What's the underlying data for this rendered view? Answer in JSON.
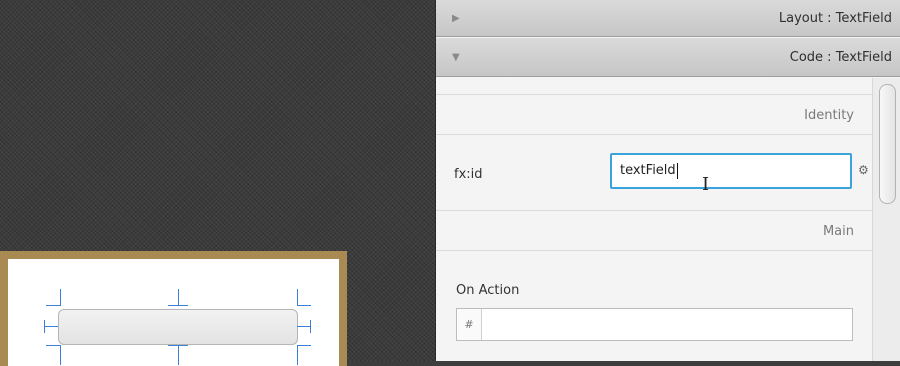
{
  "inspector": {
    "layout_header": "Layout : TextField",
    "code_header": "Code : TextField",
    "layout_arrow": "▶",
    "code_arrow": "▼",
    "sections": {
      "identity": "Identity",
      "main": "Main"
    },
    "fx_id": {
      "label": "fx:id",
      "value": "textField"
    },
    "on_action": {
      "label": "On Action",
      "prefix": "#",
      "value": ""
    },
    "gear_glyph": "⚙"
  },
  "icons": {
    "layout_collapse": "triangle-right-icon",
    "code_expand": "triangle-down-icon",
    "settings": "gear-icon",
    "cursor": "ibeam-cursor-icon"
  },
  "colors": {
    "focus_border": "#3aa3db",
    "selection_guides": "#3b7fd8",
    "container_border": "#a88a52"
  }
}
